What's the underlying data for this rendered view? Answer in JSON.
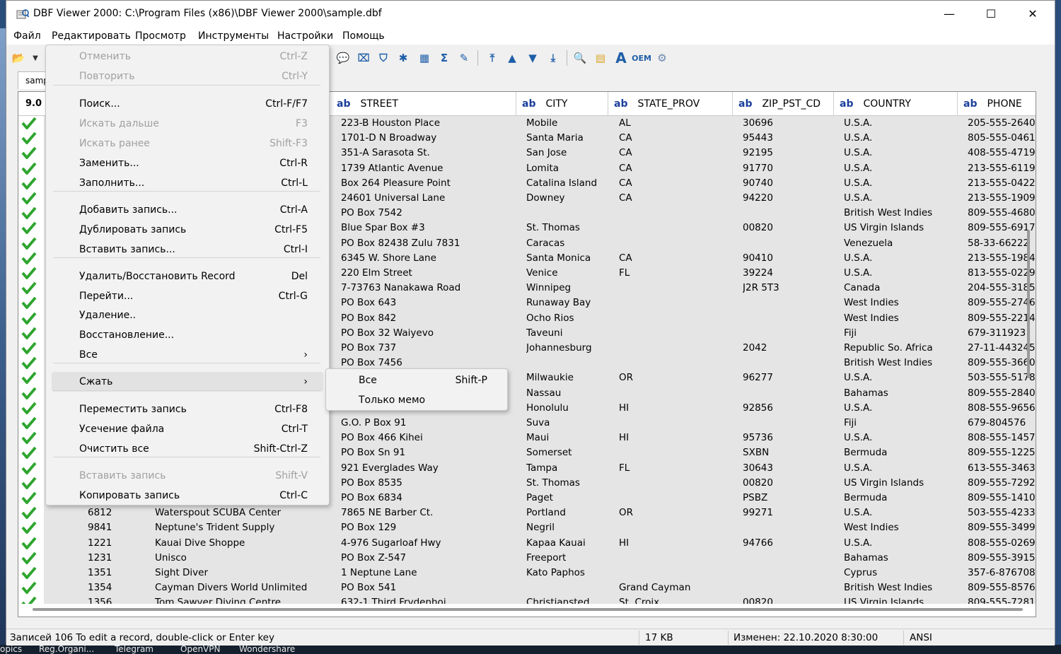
{
  "window": {
    "title": "DBF Viewer 2000: C:\\Program Files (x86)\\DBF Viewer 2000\\sample.dbf",
    "minimize_glyph": "—",
    "maximize_glyph": "☐",
    "close_glyph": "✕"
  },
  "menubar": [
    "Файл",
    "Редактировать",
    "Просмотр",
    "Инструменты",
    "Настройки",
    "Помощь"
  ],
  "tab": {
    "label": "sample"
  },
  "grid": {
    "version": "9.0",
    "type_marker": "ab",
    "columns": [
      "STREET",
      "CITY",
      "STATE_PROV",
      "ZIP_PST_CD",
      "COUNTRY",
      "PHONE"
    ],
    "rows": [
      {
        "id": "",
        "name": "",
        "street": "223-B Houston Place",
        "city": "Mobile",
        "state": "AL",
        "zip": "30696",
        "country": "U.S.A.",
        "phone": "205-555-2640"
      },
      {
        "id": "",
        "name": "",
        "street": "1701-D N Broadway",
        "city": "Santa Maria",
        "state": "CA",
        "zip": "95443",
        "country": "U.S.A.",
        "phone": "805-555-0461"
      },
      {
        "id": "",
        "name": "",
        "street": "351-A Sarasota St.",
        "city": "San Jose",
        "state": "CA",
        "zip": "92195",
        "country": "U.S.A.",
        "phone": "408-555-4719"
      },
      {
        "id": "",
        "name": "",
        "street": "1739 Atlantic Avenue",
        "city": "Lomita",
        "state": "CA",
        "zip": "91770",
        "country": "U.S.A.",
        "phone": "213-555-6119"
      },
      {
        "id": "",
        "name": "",
        "street": "Box 264 Pleasure Point",
        "city": "Catalina Island",
        "state": "CA",
        "zip": "90740",
        "country": "U.S.A.",
        "phone": "213-555-0422"
      },
      {
        "id": "",
        "name": "",
        "street": "24601 Universal Lane",
        "city": "Downey",
        "state": "CA",
        "zip": "94220",
        "country": "U.S.A.",
        "phone": "213-555-1909"
      },
      {
        "id": "",
        "name": "",
        "street": "PO Box 7542",
        "city": "",
        "state": "",
        "zip": "",
        "country": "British West Indies",
        "phone": "809-555-4680"
      },
      {
        "id": "",
        "name": "",
        "street": "Blue Spar Box #3",
        "city": "St. Thomas",
        "state": "",
        "zip": "00820",
        "country": "US Virgin Islands",
        "phone": "809-555-6917"
      },
      {
        "id": "",
        "name": "",
        "street": "PO Box 82438 Zulu 7831",
        "city": "Caracas",
        "state": "",
        "zip": "",
        "country": "Venezuela",
        "phone": "58-33-66222"
      },
      {
        "id": "",
        "name": "",
        "street": "6345 W. Shore Lane",
        "city": "Santa Monica",
        "state": "CA",
        "zip": "90410",
        "country": "U.S.A.",
        "phone": "213-555-1984"
      },
      {
        "id": "",
        "name": "",
        "street": "220 Elm Street",
        "city": "Venice",
        "state": "FL",
        "zip": "39224",
        "country": "U.S.A.",
        "phone": "813-555-0229"
      },
      {
        "id": "",
        "name": "",
        "street": "7-73763 Nanakawa Road",
        "city": "Winnipeg",
        "state": "",
        "zip": "J2R 5T3",
        "country": "Canada",
        "phone": "204-555-3185"
      },
      {
        "id": "",
        "name": "",
        "street": "PO Box 643",
        "city": "Runaway Bay",
        "state": "",
        "zip": "",
        "country": "West Indies",
        "phone": "809-555-2746"
      },
      {
        "id": "",
        "name": "",
        "street": "PO Box 842",
        "city": "Ocho Rios",
        "state": "",
        "zip": "",
        "country": "West Indies",
        "phone": "809-555-2214"
      },
      {
        "id": "",
        "name": "",
        "street": "PO Box 32 Waiyevo",
        "city": "Taveuni",
        "state": "",
        "zip": "",
        "country": "Fiji",
        "phone": "679-311923"
      },
      {
        "id": "",
        "name": "",
        "street": "PO Box 737",
        "city": "Johannesburg",
        "state": "",
        "zip": "2042",
        "country": "Republic So. Africa",
        "phone": "27-11-443245"
      },
      {
        "id": "",
        "name": "",
        "street": "PO Box 7456",
        "city": "",
        "state": "",
        "zip": "",
        "country": "British West Indies",
        "phone": "809-555-3660"
      },
      {
        "id": "",
        "name": "",
        "street": "",
        "city": "Milwaukie",
        "state": "OR",
        "zip": "96277",
        "country": "U.S.A.",
        "phone": "503-555-5178"
      },
      {
        "id": "",
        "name": "",
        "street": "",
        "city": "Nassau",
        "state": "",
        "zip": "",
        "country": "Bahamas",
        "phone": "809-555-2840"
      },
      {
        "id": "",
        "name": "",
        "street": "",
        "city": "Honolulu",
        "state": "HI",
        "zip": "92856",
        "country": "U.S.A.",
        "phone": "808-555-9656"
      },
      {
        "id": "",
        "name": "",
        "street": "G.O. P Box 91",
        "city": "Suva",
        "state": "",
        "zip": "",
        "country": "Fiji",
        "phone": "679-804576"
      },
      {
        "id": "",
        "name": "",
        "street": "PO Box 466 Kihei",
        "city": "Maui",
        "state": "HI",
        "zip": "95736",
        "country": "U.S.A.",
        "phone": "808-555-1457"
      },
      {
        "id": "",
        "name": "",
        "street": "PO Box Sn 91",
        "city": "Somerset",
        "state": "",
        "zip": "SXBN",
        "country": "Bermuda",
        "phone": "809-555-1225"
      },
      {
        "id": "",
        "name": "",
        "street": "921 Everglades Way",
        "city": "Tampa",
        "state": "FL",
        "zip": "30643",
        "country": "U.S.A.",
        "phone": "613-555-3463"
      },
      {
        "id": "",
        "name": "",
        "street": "PO Box 8535",
        "city": "St. Thomas",
        "state": "",
        "zip": "00820",
        "country": "US Virgin Islands",
        "phone": "809-555-7292"
      },
      {
        "id": "",
        "name": "",
        "street": "PO Box 6834",
        "city": "Paget",
        "state": "",
        "zip": "PSBZ",
        "country": "Bermuda",
        "phone": "809-555-1410"
      },
      {
        "id": "6812",
        "name": "Waterspout SCUBA Center",
        "street": "7865 NE Barber Ct.",
        "city": "Portland",
        "state": "OR",
        "zip": "99271",
        "country": "U.S.A.",
        "phone": "503-555-4233"
      },
      {
        "id": "9841",
        "name": "Neptune's Trident Supply",
        "street": "PO Box 129",
        "city": "Negril",
        "state": "",
        "zip": "",
        "country": "West Indies",
        "phone": "809-555-3499"
      },
      {
        "id": "1221",
        "name": "Kauai Dive Shoppe",
        "street": "4-976 Sugarloaf Hwy",
        "city": "Kapaa Kauai",
        "state": "HI",
        "zip": "94766",
        "country": "U.S.A.",
        "phone": "808-555-0269"
      },
      {
        "id": "1231",
        "name": "Unisco",
        "street": "PO Box Z-547",
        "city": "Freeport",
        "state": "",
        "zip": "",
        "country": "Bahamas",
        "phone": "809-555-3915"
      },
      {
        "id": "1351",
        "name": "Sight Diver",
        "street": "1 Neptune Lane",
        "city": "Kato Paphos",
        "state": "",
        "zip": "",
        "country": "Cyprus",
        "phone": "357-6-876708"
      },
      {
        "id": "1354",
        "name": "Cayman Divers World Unlimited",
        "street": "PO Box 541",
        "city": "",
        "state": "Grand Cayman",
        "zip": "",
        "country": "British West Indies",
        "phone": "809-555-8576"
      },
      {
        "id": "1356",
        "name": "Tom Sawyer Diving Centre",
        "street": "632-1 Third Frydenhoj",
        "city": "Christiansted",
        "state": "St. Croix",
        "zip": "00820",
        "country": "US Virgin Islands",
        "phone": "809-555-7281"
      }
    ]
  },
  "status": {
    "records": "Записей 106 To edit a record, double-click or Enter key",
    "size": "17 KB",
    "modified": "Изменен: 22.10.2020 8:30:00",
    "encoding": "ANSI"
  },
  "edit_menu": {
    "items": [
      {
        "label": "Отменить",
        "shortcut": "Ctrl-Z",
        "disabled": true
      },
      {
        "label": "Повторить",
        "shortcut": "Ctrl-Y",
        "disabled": true
      },
      {
        "label": "Поиск...",
        "shortcut": "Ctrl-F/F7"
      },
      {
        "label": "Искать дальше",
        "shortcut": "F3",
        "disabled": true
      },
      {
        "label": "Искать ранее",
        "shortcut": "Shift-F3",
        "disabled": true
      },
      {
        "label": "Заменить...",
        "shortcut": "Ctrl-R"
      },
      {
        "label": "Заполнить...",
        "shortcut": "Ctrl-L"
      },
      {
        "label": "Добавить запись...",
        "shortcut": "Ctrl-A"
      },
      {
        "label": "Дублировать запись",
        "shortcut": "Ctrl-F5"
      },
      {
        "label": "Вставить запись...",
        "shortcut": "Ctrl-I"
      },
      {
        "label": "Удалить/Восстановить Record",
        "shortcut": "Del"
      },
      {
        "label": "Перейти...",
        "shortcut": "Ctrl-G"
      },
      {
        "label": "Удаление..",
        "shortcut": ""
      },
      {
        "label": "Восстановление...",
        "shortcut": ""
      },
      {
        "label": "Все",
        "shortcut": "›"
      },
      {
        "label": "Сжать",
        "shortcut": "›",
        "highlighted": true
      },
      {
        "label": "Переместить запись",
        "shortcut": "Ctrl-F8"
      },
      {
        "label": "Усечение файла",
        "shortcut": "Ctrl-T"
      },
      {
        "label": "Очистить все",
        "shortcut": "Shift-Ctrl-Z"
      },
      {
        "label": "Вставить запись",
        "shortcut": "Shift-V",
        "disabled": true
      },
      {
        "label": "Копировать запись",
        "shortcut": "Ctrl-C"
      }
    ]
  },
  "compress_submenu": {
    "items": [
      {
        "label": "Все",
        "shortcut": "Shift-P"
      },
      {
        "label": "Только мемо",
        "shortcut": ""
      }
    ]
  },
  "taskbar": [
    "opics",
    "Reg.Organi...",
    "Telegram",
    "OpenVPN",
    "Wondershare"
  ],
  "colors": {
    "accent": "#1a3f9c",
    "check": "#2fa52f",
    "grid_bg": "#e5e5e5"
  }
}
